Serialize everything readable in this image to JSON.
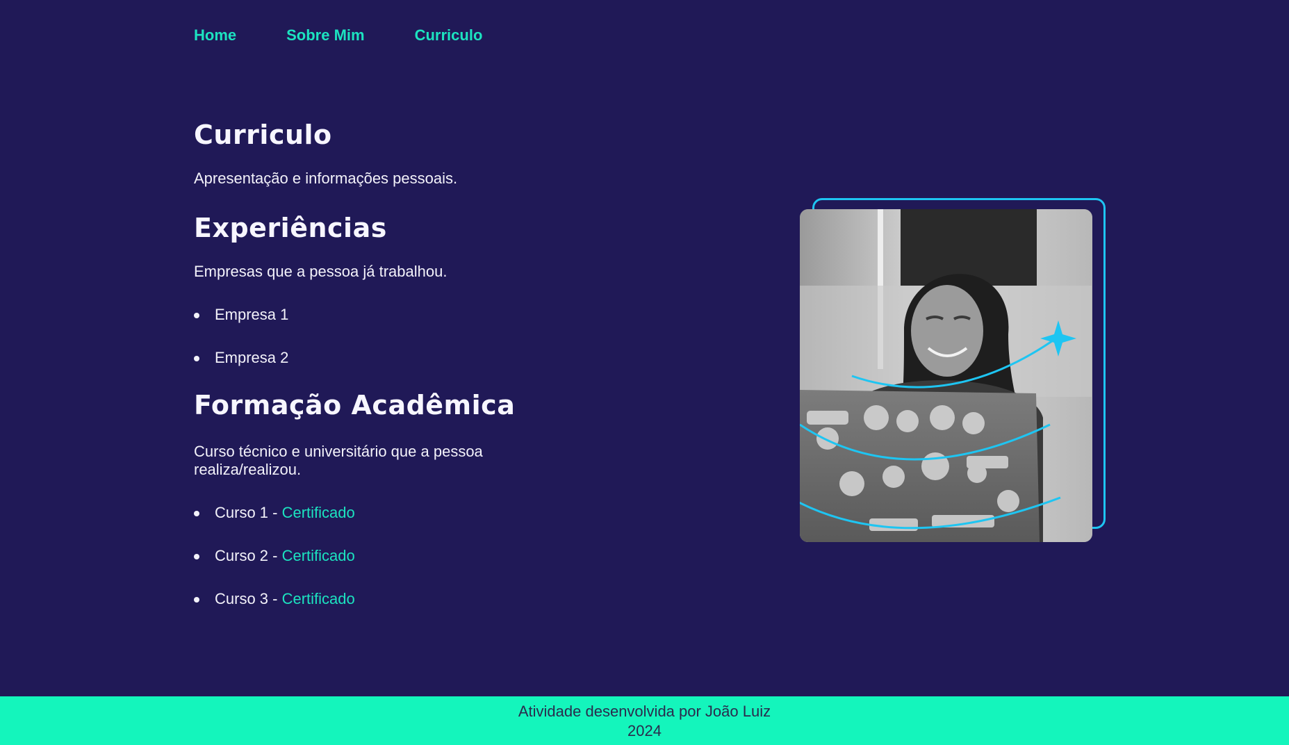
{
  "nav": {
    "items": [
      "Home",
      "Sobre Mim",
      "Curriculo"
    ]
  },
  "main": {
    "title": "Curriculo",
    "intro": "Apresentação e informações pessoais.",
    "experience": {
      "title": "Experiências",
      "description": "Empresas que a pessoa já trabalhou.",
      "items": [
        "Empresa 1",
        "Empresa 2"
      ]
    },
    "education": {
      "title": "Formação Acadêmica",
      "description": "Curso técnico e universitário que a pessoa realiza/realizou.",
      "items": [
        {
          "label": "Curso 1 - ",
          "link": "Certificado"
        },
        {
          "label": "Curso 2 - ",
          "link": "Certificado"
        },
        {
          "label": "Curso 3 - ",
          "link": "Certificado"
        }
      ]
    }
  },
  "footer": {
    "line1": "Atividade desenvolvida por João Luiz",
    "line2": "2024"
  },
  "colors": {
    "background": "#201957",
    "accent": "#1ce3c0",
    "frame": "#1ec5f2",
    "footer": "#14f5bc"
  }
}
